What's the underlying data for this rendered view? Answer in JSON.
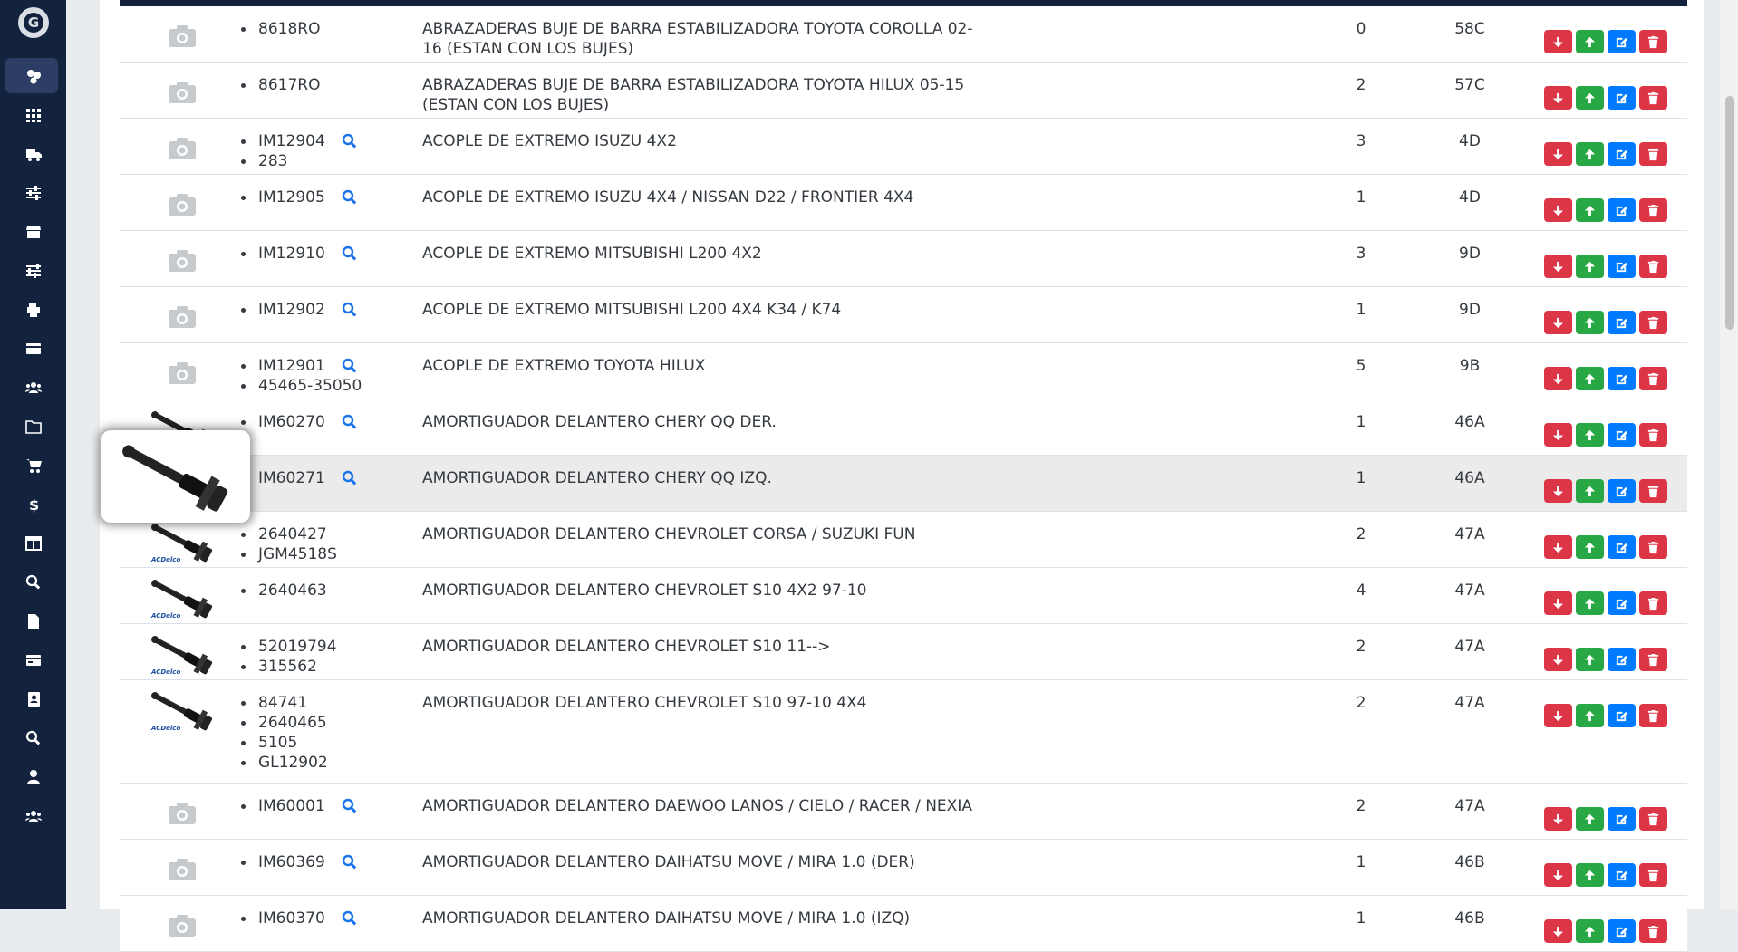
{
  "sidebar": {
    "logo_letter": "G",
    "items": [
      {
        "icon": "parts-icon",
        "active": true
      },
      {
        "icon": "grid-icon"
      },
      {
        "icon": "truck-icon"
      },
      {
        "icon": "sliders-icon"
      },
      {
        "icon": "store-icon"
      },
      {
        "icon": "sliders-alt-icon"
      },
      {
        "icon": "printer-icon"
      },
      {
        "icon": "card-icon"
      },
      {
        "icon": "users-icon"
      },
      {
        "icon": "folder-icon"
      },
      {
        "icon": "cart-icon"
      },
      {
        "icon": "dollar-icon"
      },
      {
        "icon": "table-icon"
      },
      {
        "icon": "search-icon"
      },
      {
        "icon": "file-icon"
      },
      {
        "icon": "card-alt-icon"
      },
      {
        "icon": "address-book-icon"
      },
      {
        "icon": "search-alt-icon"
      },
      {
        "icon": "user-icon"
      },
      {
        "icon": "users-alt-icon"
      }
    ]
  },
  "products": [
    {
      "thumb": "camera",
      "codes": [
        "8618RO"
      ],
      "lens": false,
      "description": "ABRAZADERAS BUJE DE BARRA ESTABILIZADORA TOYOTA COROLLA 02-16 (ESTAN CON LOS BUJES)",
      "qty": "0",
      "location": "58C"
    },
    {
      "thumb": "camera",
      "codes": [
        "8617RO"
      ],
      "lens": false,
      "description": "ABRAZADERAS BUJE DE BARRA ESTABILIZADORA TOYOTA HILUX 05-15 (ESTAN CON LOS BUJES)",
      "qty": "2",
      "location": "57C"
    },
    {
      "thumb": "camera",
      "codes": [
        "IM12904",
        "283"
      ],
      "lens": true,
      "description": "ACOPLE DE EXTREMO ISUZU 4X2",
      "qty": "3",
      "location": "4D"
    },
    {
      "thumb": "camera",
      "codes": [
        "IM12905"
      ],
      "lens": true,
      "description": "ACOPLE DE EXTREMO ISUZU 4X4 / NISSAN D22 / FRONTIER 4X4",
      "qty": "1",
      "location": "4D"
    },
    {
      "thumb": "camera",
      "codes": [
        "IM12910"
      ],
      "lens": true,
      "description": "ACOPLE DE EXTREMO MITSUBISHI L200 4X2",
      "qty": "3",
      "location": "9D"
    },
    {
      "thumb": "camera",
      "codes": [
        "IM12902"
      ],
      "lens": true,
      "description": "ACOPLE DE EXTREMO MITSUBISHI L200 4X4 K34 / K74",
      "qty": "1",
      "location": "9D"
    },
    {
      "thumb": "camera",
      "codes": [
        "IM12901",
        "45465-35050"
      ],
      "lens": true,
      "description": "ACOPLE DE EXTREMO TOYOTA HILUX",
      "qty": "5",
      "location": "9B"
    },
    {
      "thumb": "shock",
      "codes": [
        "IM60270"
      ],
      "lens": true,
      "description": "AMORTIGUADOR DELANTERO CHERY QQ DER.",
      "qty": "1",
      "location": "46A"
    },
    {
      "thumb": "shock",
      "codes": [
        "IM60271"
      ],
      "lens": true,
      "description": "AMORTIGUADOR DELANTERO CHERY QQ IZQ.",
      "qty": "1",
      "location": "46A",
      "highlight": true
    },
    {
      "thumb": "shock",
      "codes": [
        "2640427",
        "JGM4518S"
      ],
      "lens": false,
      "description": "AMORTIGUADOR DELANTERO CHEVROLET CORSA / SUZUKI FUN",
      "qty": "2",
      "location": "47A"
    },
    {
      "thumb": "shock",
      "codes": [
        "2640463"
      ],
      "lens": false,
      "description": "AMORTIGUADOR DELANTERO CHEVROLET S10 4X2 97-10",
      "qty": "4",
      "location": "47A"
    },
    {
      "thumb": "shock",
      "codes": [
        "52019794",
        "315562"
      ],
      "lens": false,
      "description": "AMORTIGUADOR DELANTERO CHEVROLET S10 11-->",
      "qty": "2",
      "location": "47A"
    },
    {
      "thumb": "shock",
      "codes": [
        "84741",
        "2640465",
        "5105",
        "GL12902"
      ],
      "lens": false,
      "description": "AMORTIGUADOR DELANTERO CHEVROLET S10 97-10 4X4",
      "qty": "2",
      "location": "47A"
    },
    {
      "thumb": "camera",
      "codes": [
        "IM60001"
      ],
      "lens": true,
      "description": "AMORTIGUADOR DELANTERO DAEWOO LANOS / CIELO / RACER / NEXIA",
      "qty": "2",
      "location": "47A"
    },
    {
      "thumb": "camera",
      "codes": [
        "IM60369"
      ],
      "lens": true,
      "description": "AMORTIGUADOR DELANTERO DAIHATSU MOVE / MIRA 1.0 (DER)",
      "qty": "1",
      "location": "46B"
    },
    {
      "thumb": "camera",
      "codes": [
        "IM60370"
      ],
      "lens": true,
      "description": "AMORTIGUADOR DELANTERO DAIHATSU MOVE / MIRA 1.0 (IZQ)",
      "qty": "1",
      "location": "46B"
    }
  ],
  "colors": {
    "sidebar": "#13233e",
    "danger": "#dc3545",
    "success": "#28a745",
    "primary": "#007bff"
  }
}
